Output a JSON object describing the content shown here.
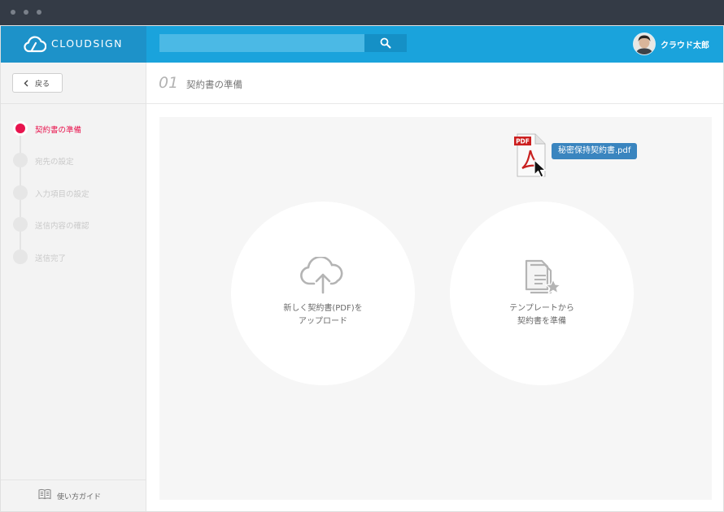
{
  "header": {
    "logo_text": "CLOUDSIGN",
    "search": {
      "placeholder": "",
      "value": ""
    },
    "user_name": "クラウド太郎"
  },
  "sidebar": {
    "back_label": "戻る",
    "steps": [
      {
        "label": "契約書の準備",
        "active": true
      },
      {
        "label": "宛先の設定",
        "active": false
      },
      {
        "label": "入力項目の設定",
        "active": false
      },
      {
        "label": "送信内容の確認",
        "active": false
      },
      {
        "label": "送信完了",
        "active": false
      }
    ],
    "guide_label": "使い方ガイド"
  },
  "main": {
    "step_number": "01",
    "step_title": "契約書の準備",
    "drag_file": {
      "badge": "PDF",
      "name": "秘密保持契約書.pdf"
    },
    "upload_card": {
      "line1": "新しく契約書(PDF)を",
      "line2": "アップロード"
    },
    "template_card": {
      "line1": "テンプレートから",
      "line2": "契約書を準備"
    }
  },
  "colors": {
    "header": "#1aa3dc",
    "logo_area": "#1d92c9",
    "accent_active": "#e8144e",
    "file_tag": "#3a85bf",
    "titlebar": "#343b46"
  },
  "icons": {
    "logo": "cloud-pen-icon",
    "search": "search-icon",
    "back": "chevron-left-icon",
    "guide": "book-icon",
    "upload": "cloud-upload-icon",
    "template": "document-star-icon",
    "file": "pdf-file-icon",
    "cursor": "mouse-cursor-icon"
  }
}
